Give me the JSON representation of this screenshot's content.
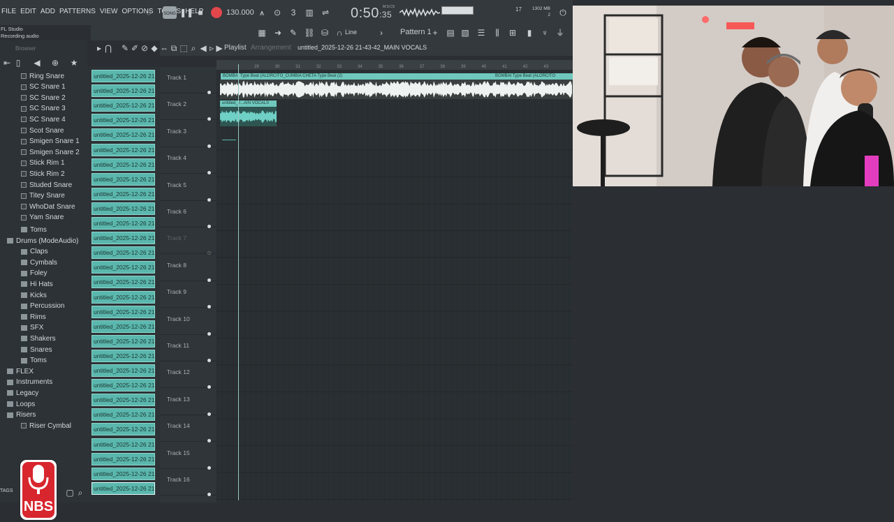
{
  "menu": [
    "FILE",
    "EDIT",
    "ADD",
    "PATTERNS",
    "VIEW",
    "OPTIONS",
    "TOOLS",
    "HELP"
  ],
  "app": {
    "name": "FL Studio",
    "status": "Recording audio"
  },
  "transport": {
    "song_label": "SONG",
    "tempo": "130.000",
    "time_main": "0:50",
    "time_sub": ":35",
    "time_label": "M:S:CS",
    "cpu": "17",
    "memory": "1302 MB",
    "memory_sub": "2"
  },
  "toolbar2": {
    "snap": "Line",
    "pattern": "Pattern 1"
  },
  "browser": {
    "title": "Browser",
    "items": [
      {
        "label": "Ring Snare",
        "type": "file",
        "indent": 1
      },
      {
        "label": "SC Snare 1",
        "type": "file",
        "indent": 1
      },
      {
        "label": "SC Snare 2",
        "type": "file",
        "indent": 1
      },
      {
        "label": "SC Snare 3",
        "type": "file",
        "indent": 1
      },
      {
        "label": "SC Snare 4",
        "type": "file",
        "indent": 1
      },
      {
        "label": "Scot Snare",
        "type": "file",
        "indent": 1
      },
      {
        "label": "Smigen Snare 1",
        "type": "file",
        "indent": 1
      },
      {
        "label": "Smigen Snare 2",
        "type": "file",
        "indent": 1
      },
      {
        "label": "Stick Rim 1",
        "type": "file",
        "indent": 1
      },
      {
        "label": "Stick Rim 2",
        "type": "file",
        "indent": 1
      },
      {
        "label": "Studed Snare",
        "type": "file",
        "indent": 1
      },
      {
        "label": "Titey Snare",
        "type": "file",
        "indent": 1
      },
      {
        "label": "WhoDat Snare",
        "type": "file",
        "indent": 1
      },
      {
        "label": "Yam Snare",
        "type": "file",
        "indent": 1
      },
      {
        "label": "Toms",
        "type": "folder",
        "indent": 1
      },
      {
        "label": "Drums (ModeAudio)",
        "type": "folder",
        "indent": 0
      },
      {
        "label": "Claps",
        "type": "folder",
        "indent": 1
      },
      {
        "label": "Cymbals",
        "type": "folder",
        "indent": 1
      },
      {
        "label": "Foley",
        "type": "folder",
        "indent": 1
      },
      {
        "label": "Hi Hats",
        "type": "folder",
        "indent": 1
      },
      {
        "label": "Kicks",
        "type": "folder",
        "indent": 1
      },
      {
        "label": "Percussion",
        "type": "folder",
        "indent": 1
      },
      {
        "label": "Rims",
        "type": "folder",
        "indent": 1
      },
      {
        "label": "SFX",
        "type": "folder",
        "indent": 1
      },
      {
        "label": "Shakers",
        "type": "folder",
        "indent": 1
      },
      {
        "label": "Snares",
        "type": "folder",
        "indent": 1
      },
      {
        "label": "Toms",
        "type": "folder",
        "indent": 1
      },
      {
        "label": "FLEX",
        "type": "folder",
        "indent": 0
      },
      {
        "label": "Instruments",
        "type": "folder",
        "indent": 0
      },
      {
        "label": "Legacy",
        "type": "folder",
        "indent": 0
      },
      {
        "label": "Loops",
        "type": "folder",
        "indent": 0
      },
      {
        "label": "Risers",
        "type": "folder",
        "indent": 0
      },
      {
        "label": "Riser Cymbal",
        "type": "file",
        "indent": 1
      }
    ],
    "tags_label": "TAGS",
    "logo_text": "NBS"
  },
  "channels": {
    "label": "untitled_2025-12-26 21-",
    "count": 29
  },
  "playlist": {
    "title": "Playlist",
    "subtitle": "Arrangement",
    "file": "untitled_2025-12-26 21-43-42_MAIN VOCALS",
    "tracks": [
      "Track 1",
      "Track 2",
      "Track 3",
      "Track 4",
      "Track 5",
      "Track 6",
      "Track 7",
      "Track 8",
      "Track 9",
      "Track 10",
      "Track 11",
      "Track 12",
      "Track 13",
      "Track 14",
      "Track 15",
      "Track 16"
    ],
    "bars": [
      "29",
      "30",
      "31",
      "32",
      "33",
      "34",
      "35",
      "36",
      "37",
      "38",
      "39",
      "40",
      "41",
      "42",
      "43"
    ],
    "clip1_label": "BOMBAI Type Beat (ALORCITO_CUMBIA CHETA Type Beat (2)",
    "clip1b_label": "BOMBAI Type Beat (ALORCITO",
    "clip2_label": "untitled_2...AIN VOCALS"
  },
  "colors": {
    "clip": "#5ab7ad",
    "record": "#e2474b",
    "background": "#2b2f33"
  }
}
